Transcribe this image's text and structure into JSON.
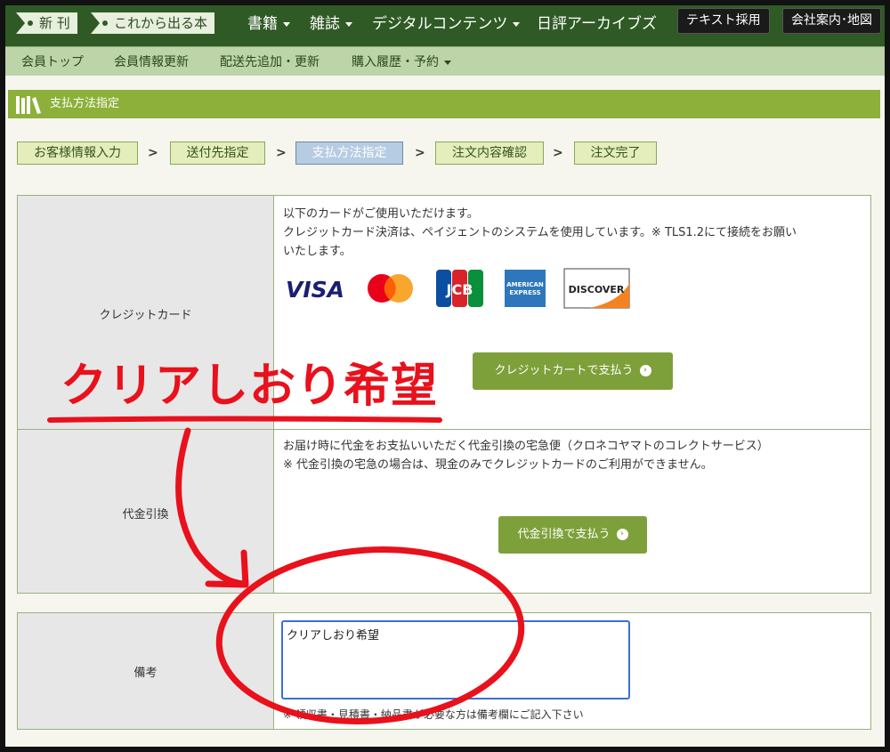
{
  "topnav": {
    "tag_new": "新 刊",
    "tag_upcoming": "これから出る本",
    "books": "書籍",
    "magazines": "雑誌",
    "digital": "デジタルコンテンツ",
    "archives": "日評アーカイブズ",
    "textbook_btn": "テキスト採用",
    "company_btn": "会社案内･地図"
  },
  "subnav": {
    "items": [
      "会員トップ",
      "会員情報更新",
      "配送先追加・更新",
      "購入履歴・予約"
    ]
  },
  "page": {
    "title": "支払方法指定"
  },
  "steps": [
    "お客様情報入力",
    "送付先指定",
    "支払方法指定",
    "注文内容確認",
    "注文完了"
  ],
  "step_separator": ">",
  "payment": {
    "credit": {
      "label": "クレジットカード",
      "line1": "以下のカードがご使用いただけます。",
      "line2": "クレジットカード決済は、ペイジェントのシステムを使用しています。※ TLS1.2にて接続をお願い",
      "line3": "いたします。",
      "button": "クレジットカートで支払う",
      "cards": {
        "visa": "VISA",
        "jcb": "JCB",
        "amex1": "AMERICAN",
        "amex2": "EXPRESS",
        "discover": "DISCOVER"
      }
    },
    "cod": {
      "label": "代金引換",
      "line1": "お届け時に代金をお支払いいただく代金引換の宅急便（クロネコヤマトのコレクトサービス）",
      "line2": "※ 代金引換の宅急の場合は、現金のみでクレジットカードのご利用ができません。",
      "button": "代金引換で支払う"
    }
  },
  "remarks": {
    "label": "備考",
    "value": "クリアしおり希望",
    "note": "※ 領収書・見積書・納品書が必要な方は備考欄にご記入下さい"
  },
  "annotation": {
    "text": "クリアしおり希望",
    "color": "#e8111c"
  }
}
